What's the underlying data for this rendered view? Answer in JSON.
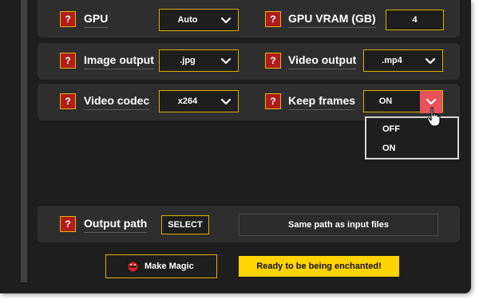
{
  "settings": {
    "gpu": {
      "help": "?",
      "label": "GPU",
      "value": "Auto"
    },
    "gpu_vram": {
      "help": "?",
      "label": "GPU VRAM (GB)",
      "value": "4"
    },
    "image_output": {
      "help": "?",
      "label": "Image output",
      "value": ".jpg"
    },
    "video_output": {
      "help": "?",
      "label": "Video output",
      "value": ".mp4"
    },
    "video_codec": {
      "help": "?",
      "label": "Video codec",
      "value": "x264"
    },
    "keep_frames": {
      "help": "?",
      "label": "Keep frames",
      "value": "ON",
      "options": [
        "OFF",
        "ON"
      ]
    }
  },
  "output": {
    "help": "?",
    "label": "Output path",
    "select_button": "SELECT",
    "path_display": "Same path as input files"
  },
  "actions": {
    "make_magic": "Make Magic",
    "status": "Ready to be being enchanted!"
  },
  "colors": {
    "background": "#1e1e1e",
    "panel": "#2e2e2e",
    "accent_border": "#d8b000",
    "help_red": "#b01c1c",
    "open_chevron": "#e8525a",
    "status_yellow": "#ffd400"
  },
  "icons": {
    "help": "question-mark-icon",
    "dropdown": "chevron-down-icon",
    "magic": "magic-wand-icon",
    "pointer": "hand-pointer-icon"
  }
}
